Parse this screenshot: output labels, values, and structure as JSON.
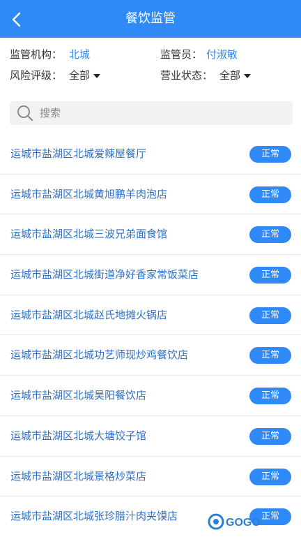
{
  "header": {
    "title": "餐饮监管"
  },
  "filters": {
    "agency_label": "监管机构：",
    "agency_value": "北城",
    "supervisor_label": "监管员：",
    "supervisor_value": "付淑敏",
    "risk_label": "风险评级：",
    "risk_value": "全部",
    "business_label": "营业状态：",
    "business_value": "全部"
  },
  "search": {
    "placeholder": "搜索"
  },
  "list": {
    "items": [
      {
        "name": "运城市盐湖区北城爱辣屋餐厅",
        "status": "正常"
      },
      {
        "name": "运城市盐湖区北城黄旭鹏羊肉泡店",
        "status": "正常"
      },
      {
        "name": "运城市盐湖区北城三波兄弟面食馆",
        "status": "正常"
      },
      {
        "name": "运城市盐湖区北城街道净好香家常饭菜店",
        "status": "正常"
      },
      {
        "name": "运城市盐湖区北城赵氏地摊火锅店",
        "status": "正常"
      },
      {
        "name": "运城市盐湖区北城功艺师现炒鸡餐饮店",
        "status": "正常"
      },
      {
        "name": "运城市盐湖区北城昊阳餐饮店",
        "status": "正常"
      },
      {
        "name": "运城市盐湖区北城大塘饺子馆",
        "status": "正常"
      },
      {
        "name": "运城市盐湖区北城景格炒菜店",
        "status": "正常"
      },
      {
        "name": "运城市盐湖区北城张珍腊汁肉夹馍店",
        "status": "正常"
      }
    ]
  },
  "colors": {
    "accent": "#2f89f6",
    "link": "#2f6fc4"
  },
  "watermark": {
    "text": "GOGO"
  }
}
